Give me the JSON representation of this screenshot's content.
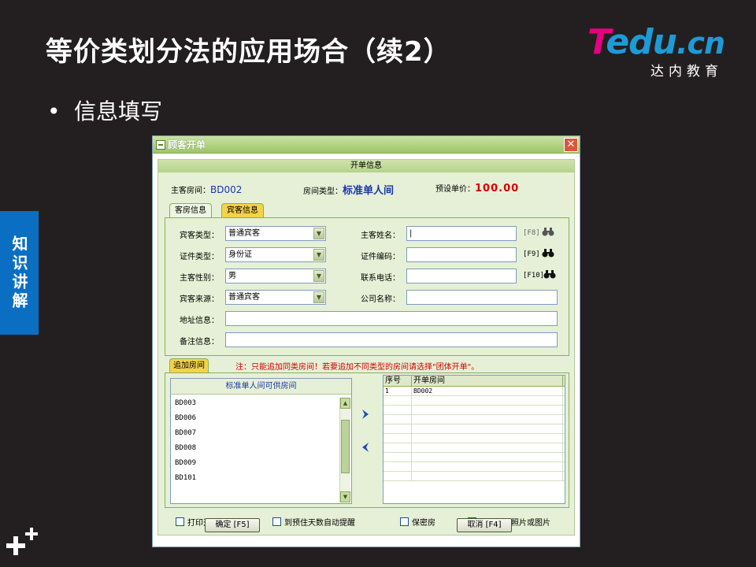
{
  "slide": {
    "title": "等价类划分法的应用场合（续2）",
    "bullet": "信息填写",
    "side_tab": "知识讲解",
    "logo_t": "T",
    "logo_edu": "edu",
    "logo_cn": ".cn",
    "logo_sub": "达内教育"
  },
  "dialog": {
    "title": "顾客开单",
    "close": "✕",
    "section_title": "开单信息",
    "main_room_label": "主客房间：",
    "main_room_value": "BD002",
    "room_type_label": "房间类型：",
    "room_type_value": "标准单人间",
    "price_label": "预设单价：",
    "price_value": "100.00",
    "tabs": [
      {
        "label": "客房信息",
        "active": false
      },
      {
        "label": "宾客信息",
        "active": true
      }
    ],
    "form": {
      "guest_type_label": "宾客类型：",
      "guest_type_value": "普通宾客",
      "id_type_label": "证件类型：",
      "id_type_value": "身份证",
      "gender_label": "主客性别：",
      "gender_value": "男",
      "source_label": "宾客来源：",
      "source_value": "普通宾客",
      "address_label": "地址信息：",
      "remark_label": "备注信息：",
      "name_label": "主客姓名：",
      "id_no_label": "证件编码：",
      "phone_label": "联系电话：",
      "company_label": "公司名称：",
      "hotkey_f8": "[F8]",
      "hotkey_f9": "[F9]",
      "hotkey_f10": "[F10]"
    },
    "add_room": {
      "tab_label": "追加房间",
      "note": "注：只能追加同类房间！若要追加不同类型的房间请选择\"团体开单\"。",
      "list_title": "标准单人间可供房间",
      "available_rooms": [
        "BD003",
        "BD006",
        "BD007",
        "BD008",
        "BD009",
        "BD101"
      ],
      "grid_headers": [
        "序号",
        "开单房间"
      ],
      "grid_rows": [
        [
          "1",
          "BD002"
        ]
      ],
      "move_right": "›",
      "move_left": "‹"
    },
    "checkboxes": [
      "打印开单信息",
      "到预住天数自动提醒",
      "保密房",
      "加载证件照片或图片"
    ],
    "ok_button": "确定 [F5]",
    "cancel_button": "取消 [F4]"
  }
}
